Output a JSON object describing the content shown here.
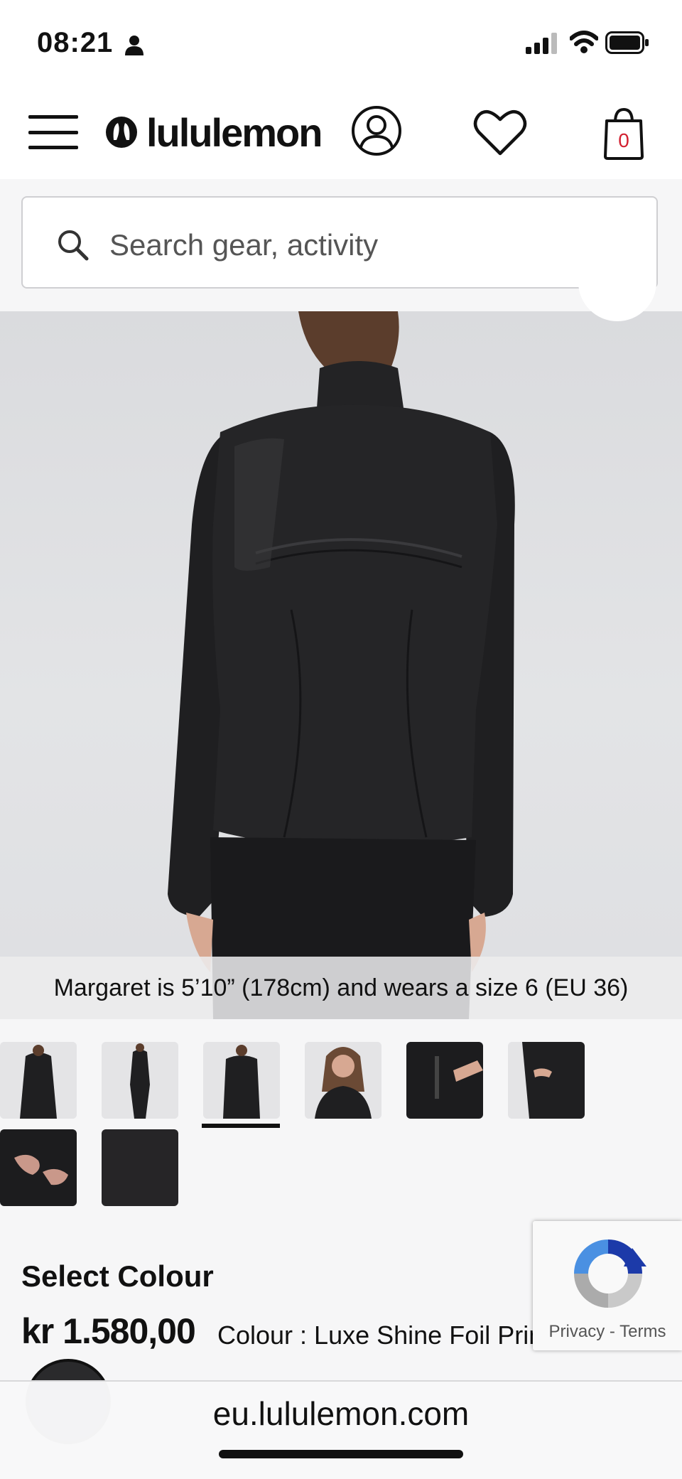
{
  "status_bar": {
    "time": "08:21"
  },
  "header": {
    "brand": "lululemon",
    "bag_count": "0"
  },
  "search": {
    "placeholder": "Search gear, activity"
  },
  "product": {
    "model_caption": "Margaret is 5’10” (178cm) and wears a size 6 (EU 36)",
    "select_colour_label": "Select Colour",
    "price": "kr 1.580,00",
    "colour_label": "Colour : Luxe Shine Foil Prin",
    "thumbnails": [
      "front",
      "full-body",
      "back",
      "portrait",
      "pocket-detail",
      "cuff-detail",
      "thumbhole-detail",
      "fabric-swatch"
    ],
    "active_thumbnail": 2
  },
  "recaptcha": {
    "privacy": "Privacy",
    "separator": " - ",
    "terms": "Terms"
  },
  "browser": {
    "url": "eu.lululemon.com"
  },
  "colors": {
    "accent_red": "#d22030",
    "text": "#111111",
    "background": "#f6f6f7"
  }
}
